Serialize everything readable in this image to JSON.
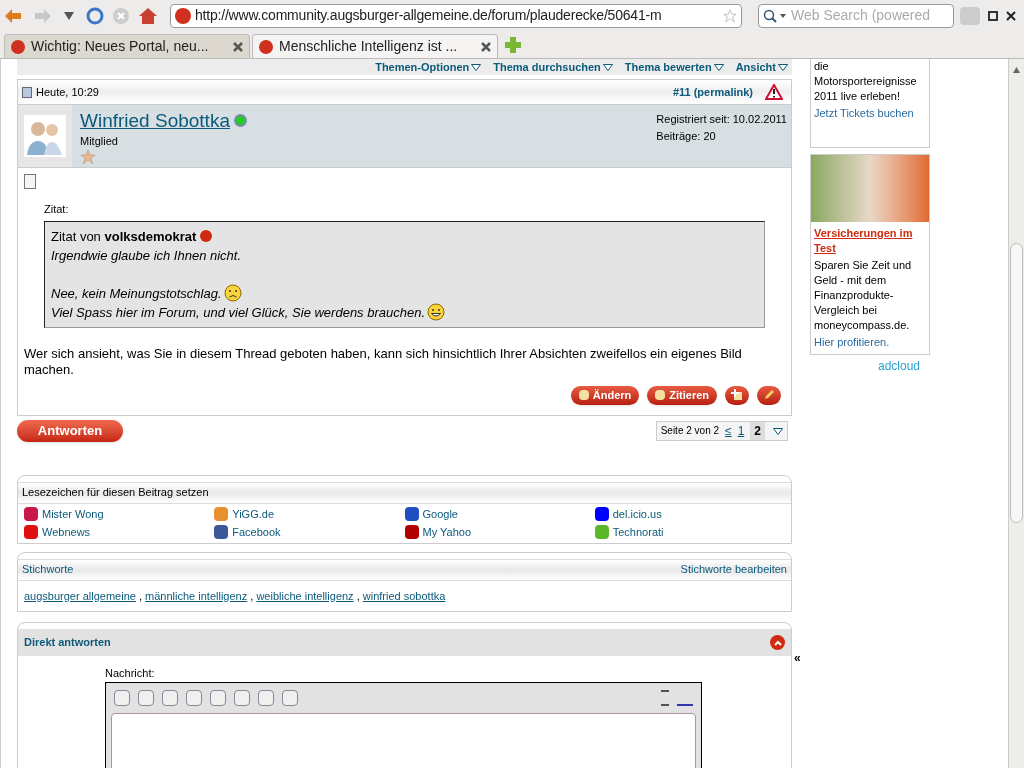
{
  "browser": {
    "url": "http://www.community.augsburger-allgemeine.de/forum/plauderecke/50641-m",
    "search": {
      "placeholder": "Web Search (powered"
    },
    "tabs": [
      {
        "title": "Wichtig: Neues Portal, neu...",
        "selected": false
      },
      {
        "title": "Menschliche Intelligenz ist ...",
        "selected": true
      }
    ]
  },
  "thread_menu": [
    "Themen-Optionen",
    "Thema durchsuchen",
    "Thema bewerten",
    "Ansicht"
  ],
  "post": {
    "date": "Heute, 10:29",
    "number": "#11 (permalink)",
    "author": "Winfried Sobottka",
    "online": true,
    "role": "Mitglied",
    "registered": "Registriert seit: 10.02.2011",
    "count": "Beiträge: 20",
    "quote": {
      "label": "Zitat:",
      "prefix": "Zitat von",
      "user": "volksdemokrat",
      "lines": [
        {
          "kind": "plain",
          "text": "Irgendwie glaube ich Ihnen nicht."
        },
        {
          "kind": "blank"
        },
        {
          "kind": "sad",
          "text": "Nee, kein Meinungstotschlag."
        },
        {
          "kind": "grin",
          "text": "Viel Spass hier im Forum, und viel Glück, Sie werdens brauchen."
        }
      ]
    },
    "body": "Wer sich ansieht, was Sie in diesem Thread geboten haben, kann sich hinsichtlich Ihrer Absichten zweifellos ein eigenes Bild machen.",
    "buttons": [
      "Ändern",
      "Zitieren"
    ]
  },
  "reply_button": "Antworten",
  "pagination": {
    "label": "Seite 2 von 2",
    "prev": "≤",
    "pages": [
      {
        "label": "1",
        "selected": false
      },
      {
        "label": "2",
        "selected": true
      }
    ]
  },
  "bookmarks": {
    "title": "Lesezeichen für diesen Beitrag setzen",
    "items": [
      "Mister Wong",
      "Webnews",
      "YiGG.de",
      "Facebook",
      "Google",
      "My Yahoo",
      "del.icio.us",
      "Technorati"
    ]
  },
  "tags": {
    "title": "Stichworte",
    "edit": "Stichworte bearbeiten",
    "separator": ",",
    "items": [
      "augsburger allgemeine",
      "männliche intelligenz",
      "weibliche intelligenz",
      "winfried sobottka"
    ]
  },
  "quick_reply": {
    "title": "Direkt antworten",
    "label": "Nachricht:",
    "toggle": "«"
  },
  "ads": [
    {
      "text": "die Motorsportereignisse 2011 live erleben!",
      "link": "Jetzt Tickets buchen"
    },
    {
      "title": "Versicherungen im Test",
      "text": "Sparen Sie Zeit und Geld - mit dem Finanzprodukte-Vergleich bei moneycompass.de.",
      "link": "Hier profitieren."
    }
  ],
  "ad_brand": "adcloud"
}
